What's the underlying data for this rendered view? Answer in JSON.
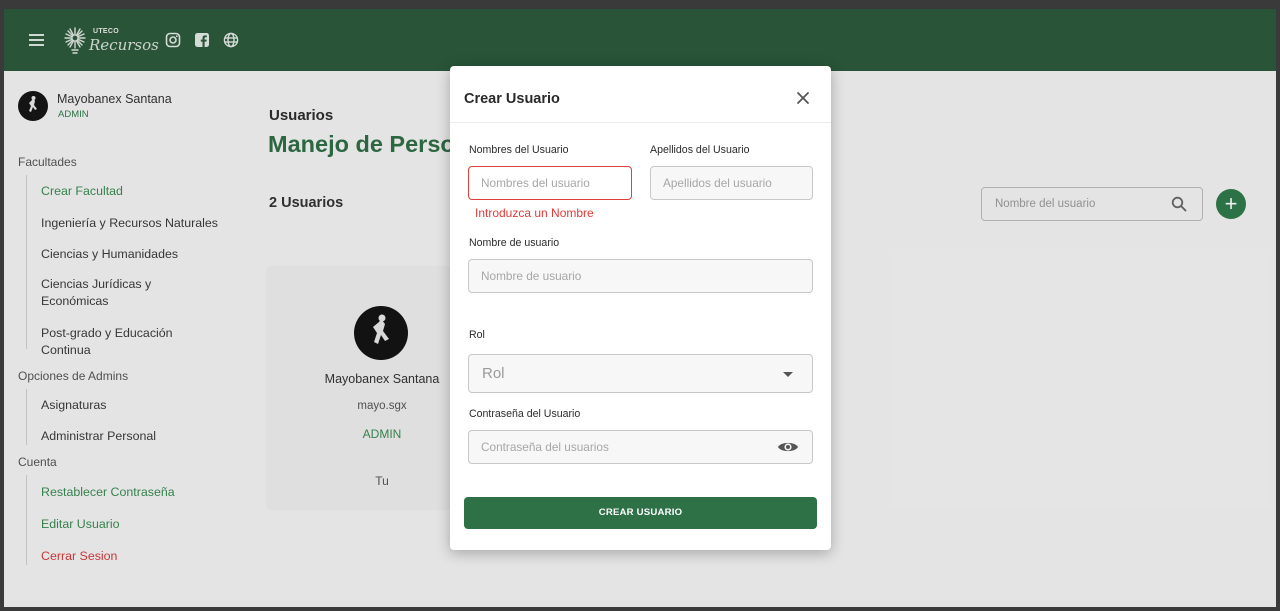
{
  "header": {
    "logo_small_text": "UTECO",
    "logo_script_text": "Recursos",
    "icons": [
      "menu-icon",
      "logo-icon",
      "instagram-icon",
      "facebook-icon",
      "globe-icon"
    ]
  },
  "sidebar": {
    "user": {
      "name": "Mayobanex Santana",
      "role": "ADMIN"
    },
    "sections": [
      {
        "title": "Facultades",
        "items": [
          "Crear Facultad",
          "Ingeniería y Recursos Naturales",
          "Ciencias y Humanidades",
          "Ciencias Jurídicas y Económicas",
          "Post-grado y Educación Continua"
        ]
      },
      {
        "title": "Opciones de Admins",
        "items": [
          "Asignaturas",
          "Administrar Personal"
        ]
      },
      {
        "title": "Cuenta",
        "items": [
          "Restablecer Contraseña",
          "Editar Usuario",
          "Cerrar Sesion"
        ]
      }
    ]
  },
  "main": {
    "subtitle": "Usuarios",
    "title": "Manejo de Personal",
    "count": "2 Usuarios",
    "search_placeholder": "Nombre del usuario",
    "add_button": "+",
    "card": {
      "name": "Mayobanex Santana",
      "username": "mayo.sgx",
      "role": "ADMIN",
      "tag": "Tu"
    }
  },
  "modal": {
    "title": "Crear Usuario",
    "first_name": {
      "label": "Nombres del Usuario",
      "placeholder": "Nombres del usuario",
      "error": "Introduzca un Nombre"
    },
    "last_name": {
      "label": "Apellidos del Usuario",
      "placeholder": "Apellidos del usuario"
    },
    "username": {
      "label": "Nombre de usuario",
      "placeholder": "Nombre de usuario"
    },
    "role": {
      "label": "Rol",
      "value": "Rol"
    },
    "password": {
      "label": "Contraseña del Usuario",
      "placeholder": "Contraseña del usuarios"
    },
    "submit": "CREAR USUARIO"
  },
  "colors": {
    "header_bg": "#2c5a3b",
    "accent_green": "#2f7a4b",
    "error_red": "#df3b36",
    "logout_red": "#d33b3b"
  }
}
